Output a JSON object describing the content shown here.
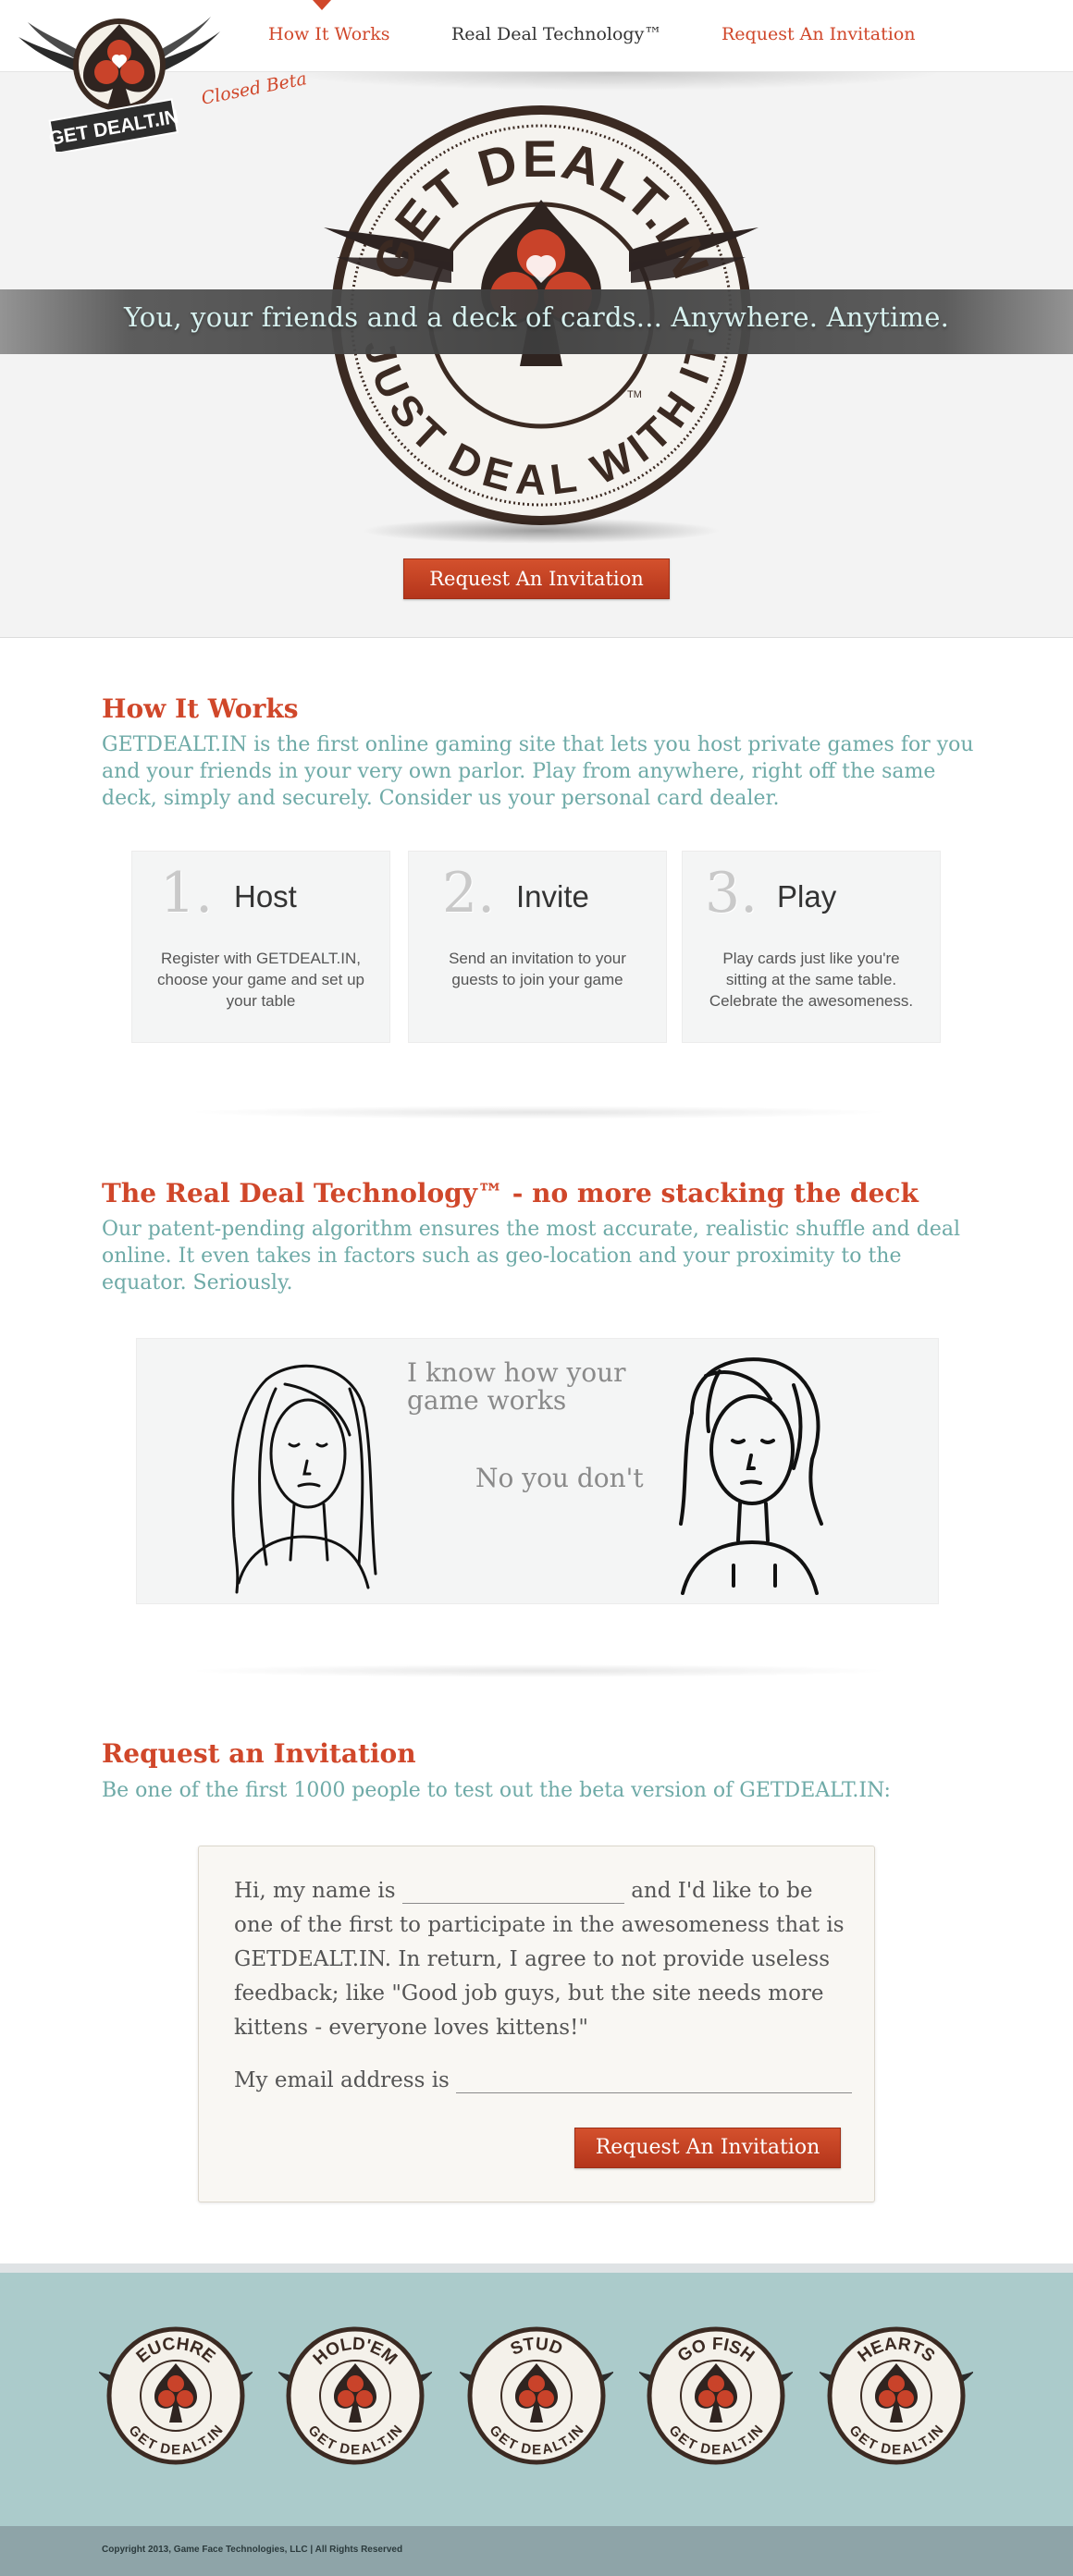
{
  "nav": {
    "how": "How It Works",
    "tech": "Real Deal Technology™",
    "invite": "Request An Invitation"
  },
  "logo": {
    "text": "GET DEALT.IN",
    "badge": "Closed Beta"
  },
  "hero": {
    "stamp_top": "GET DEALT.IN",
    "stamp_bottom": "JUST DEAL WITH IT",
    "stamp_tm": "TM",
    "tagline": "You, your friends and a deck of cards... Anywhere.  Anytime.",
    "button": "Request An Invitation"
  },
  "how_it_works": {
    "title": "How It Works",
    "body": "GETDEALT.IN is the first online gaming site that lets you host private games for you and your friends in your very own parlor. Play from anywhere, right off the same deck, simply and securely. Consider us your personal card dealer.",
    "steps": [
      {
        "num": "1.",
        "title": "Host",
        "desc": "Register with GETDEALT.IN, choose your game and set up your table"
      },
      {
        "num": "2.",
        "title": "Invite",
        "desc": "Send an invitation to your guests to join your game"
      },
      {
        "num": "3.",
        "title": "Play",
        "desc": "Play cards just like you're sitting at the same table. Celebrate the awesomeness."
      }
    ]
  },
  "technology": {
    "title": "The Real Deal Technology™ - no more stacking the deck",
    "body": "Our patent-pending algorithm ensures the most accurate, realistic shuffle and deal online. It even takes in factors such as geo-location and your proximity to the equator. Seriously.",
    "comic_line1": "I know how your game works",
    "comic_line2": "No you don't"
  },
  "invitation": {
    "title": "Request an Invitation",
    "subtitle": "Be one of the first 1000 people to test out the beta version of GETDEALT.IN:",
    "text_before": "Hi, my name is",
    "text_after": "and I'd like to be one of the first to participate in the awesomeness that is GETDEALT.IN. In return, I agree to not provide useless feedback; like \"Good job guys, but the site needs more kittens - everyone loves kittens!\"",
    "email_label": "My email address is",
    "name_value": "",
    "email_value": "",
    "button": "Request An Invitation"
  },
  "games": [
    {
      "name": "EUCHRE",
      "brand": "GET DEALT.IN"
    },
    {
      "name": "HOLD'EM",
      "brand": "GET DEALT.IN"
    },
    {
      "name": "STUD",
      "brand": "GET DEALT.IN"
    },
    {
      "name": "GO FISH",
      "brand": "GET DEALT.IN"
    },
    {
      "name": "HEARTS",
      "brand": "GET DEALT.IN"
    }
  ],
  "footer": {
    "copyright": "Copyright 2013, Game Face Technologies, LLC | All Rights Reserved"
  },
  "colors": {
    "accent": "#d0472a",
    "teal_text": "#6eaaa7",
    "footer_teal": "#abcbcb",
    "dark_brown": "#3b2a22"
  }
}
